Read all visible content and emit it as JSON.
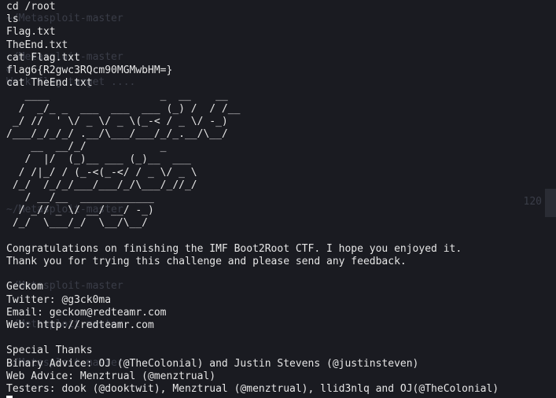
{
  "background_ghost_text": "\n~/Metasploit-master\n\n\n~/Metasploit-master\n# \nWork flag target ....\n\n\n\n\n\n\n\n\n\n~/Metasploit-master\n\n\n\n\n\n~/Metasploit-master\n\n\n~/Metasploit-master\n\n\n~/Metasploit-master",
  "background_ghost_right": "120",
  "terminal_output": "cd /root\nls\nFlag.txt\nTheEnd.txt\ncat Flag.txt\nflag6{R2gwc3RQcm90MGMwbHM=}\ncat TheEnd.txt\n   ____                  _  __    __\n  /  _/_ _  ___  ___  ___ (_) /  / /__\n _/ //  ' \\/ _ \\/ _ \\(_-< / _ \\/ -_)\n/___/_/_/_/ .__/\\___/___/_/_.__/\\__/\n    __  __/_/            _\n   /  |/  (_)__ ___ (_)__  ___\n  / /|_/ / (_-<(_-</ / _ \\/ _ \\\n /_/  /_/_/___/___/_/\\___/_//_/\n   / __/__  ____________\n  / _// _ \\/ __/ __/ -_)\n /_/  \\___/_/  \\__/\\__/\n\nCongratulations on finishing the IMF Boot2Root CTF. I hope you enjoyed it.\nThank you for trying this challenge and please send any feedback.\n\nGeckom\nTwitter: @g3ck0ma\nEmail: geckom@redteamr.com\nWeb: http://redteamr.com\n\nSpecial Thanks\nBinary Advice: OJ (@TheColonial) and Justin Stevens (@justinsteven)\nWeb Advice: Menztrual (@menztrual)\nTesters: dook (@dooktwit), Menztrual (@menztrual), llid3nlq and OJ(@TheColonial)",
  "colors": {
    "background": "#1a1b21",
    "foreground": "#e6e6e6",
    "ghost_text": "#3a3d48",
    "cursor": "#ffffff"
  }
}
